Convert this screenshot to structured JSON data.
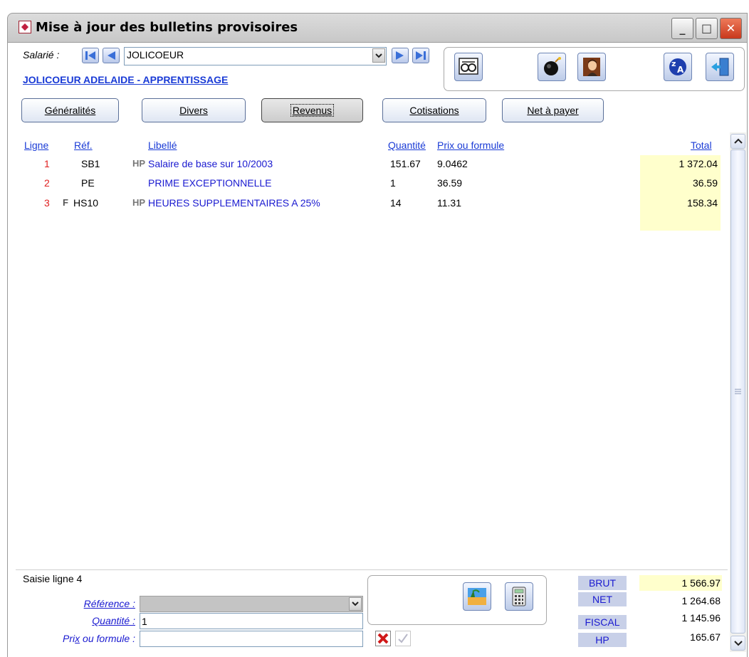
{
  "window": {
    "title": "Mise à jour des bulletins provisoires",
    "minimize": "_",
    "maximize": "□",
    "close": "✕"
  },
  "header": {
    "salarie_label": "Salarié :",
    "employee_selected": "JOLICOEUR",
    "employee_fullname": "JOLICOEUR ADELAIDE - APPRENTISSAGE"
  },
  "tabs": [
    {
      "label": "Généralités",
      "active": false
    },
    {
      "label": "Divers",
      "active": false
    },
    {
      "label": "Revenus",
      "active": true
    },
    {
      "label": "Cotisations",
      "active": false
    },
    {
      "label": "Net à payer",
      "active": false
    }
  ],
  "table": {
    "headers": {
      "ligne": "Ligne",
      "ref": "Réf.",
      "libelle": "Libellé",
      "quantite": "Quantité",
      "prix": "Prix ou formule",
      "total": "Total"
    },
    "rows": [
      {
        "ligne": "1",
        "flag": "",
        "ref": "SB1",
        "tag": "HP",
        "libelle": "Salaire de base sur 10/2003",
        "quantite": "151.67",
        "prix": "9.0462",
        "total": "1 372.04"
      },
      {
        "ligne": "2",
        "flag": "",
        "ref": "PE",
        "tag": "",
        "libelle": "PRIME EXCEPTIONNELLE",
        "quantite": "1",
        "prix": "36.59",
        "total": "36.59"
      },
      {
        "ligne": "3",
        "flag": "F",
        "ref": "HS10",
        "tag": "HP",
        "libelle": "HEURES SUPPLEMENTAIRES A 25%",
        "quantite": "14",
        "prix": "11.31",
        "total": "158.34"
      }
    ]
  },
  "entry": {
    "title": "Saisie ligne 4",
    "reference_label_u": "R",
    "reference_label_rest": "éférence :",
    "quantite_label_u": "Q",
    "quantite_label_rest": "uantité :",
    "prix_label_a": "Pri",
    "prix_label_u": "x",
    "prix_label_b": " ou formule :",
    "reference_value": "",
    "quantite_value": "1",
    "prix_value": ""
  },
  "summary": {
    "brut_label": "BRUT",
    "brut_value": "1 566.97",
    "net_label": "NET",
    "net_value": "1 264.68",
    "fiscal_label": "FISCAL",
    "fiscal_value": "1 145.96",
    "hp_label": "HP",
    "hp_value": "165.67"
  },
  "icons": {
    "nav": [
      "first-icon",
      "previous-icon",
      "next-icon",
      "last-icon"
    ],
    "tools": [
      "glasses-icon",
      "bomb-icon",
      "person-icon",
      "sort-za-icon",
      "exit-door-icon"
    ],
    "entry": [
      "landscape-icon",
      "calculator-icon",
      "cancel-icon",
      "validate-icon"
    ]
  },
  "colors": {
    "accent_blue": "#1a3bd6",
    "line_red": "#e02020",
    "total_bg": "#ffffcc",
    "summary_label_bg": "#c8d0e8"
  }
}
